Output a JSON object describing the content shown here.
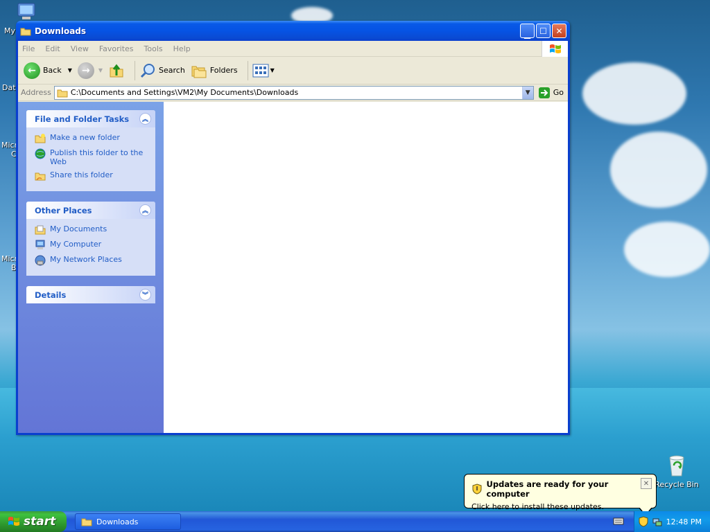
{
  "desktop": {
    "partial_labels": [
      "My",
      "Dat",
      "Micr",
      "C",
      "Micr",
      "B"
    ],
    "recycle_bin_label": "Recycle Bin"
  },
  "window": {
    "title": "Downloads",
    "menu": [
      "File",
      "Edit",
      "View",
      "Favorites",
      "Tools",
      "Help"
    ],
    "toolbar": {
      "back_label": "Back",
      "search_label": "Search",
      "folders_label": "Folders"
    },
    "address": {
      "label": "Address",
      "value": "C:\\Documents and Settings\\VM2\\My Documents\\Downloads",
      "go_label": "Go"
    },
    "taskpane": {
      "file_tasks": {
        "title": "File and Folder Tasks",
        "items": [
          "Make a new folder",
          "Publish this folder to the Web",
          "Share this folder"
        ]
      },
      "other_places": {
        "title": "Other Places",
        "items": [
          "My Documents",
          "My Computer",
          "My Network Places"
        ]
      },
      "details": {
        "title": "Details"
      }
    }
  },
  "taskbar": {
    "start_label": "start",
    "task_label": "Downloads",
    "clock": "12:48 PM"
  },
  "balloon": {
    "title": "Updates are ready for your computer",
    "text": "Click here to install these updates."
  }
}
